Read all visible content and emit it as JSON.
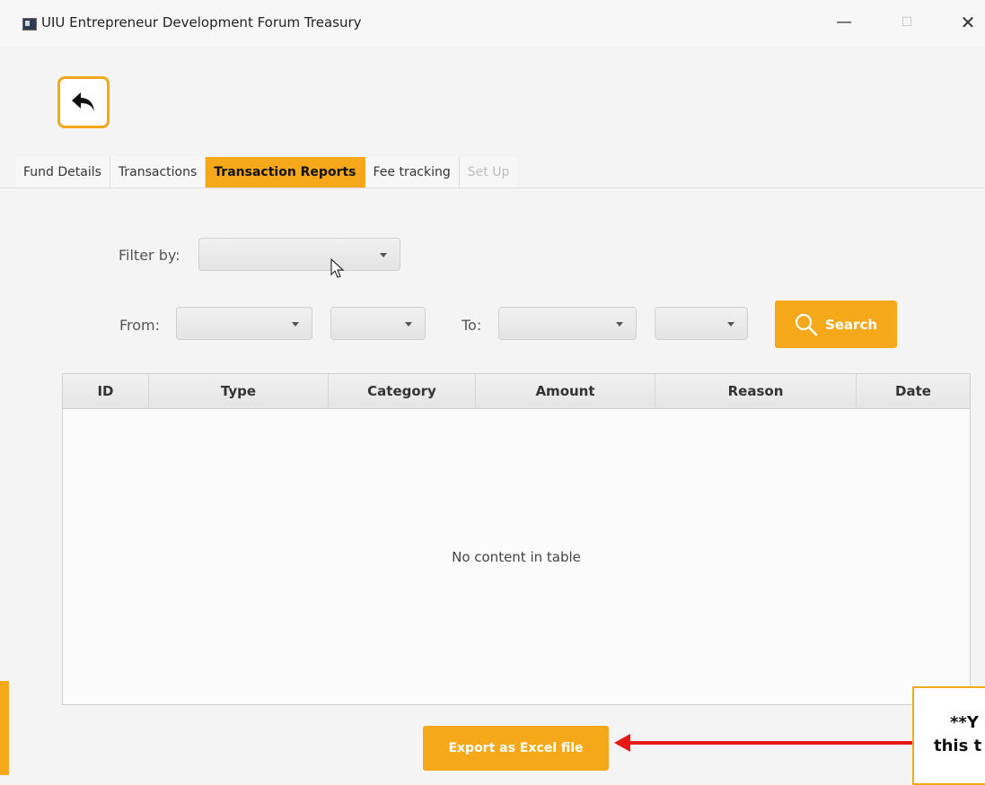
{
  "window": {
    "title": "UIU Entrepreneur Development Forum Treasury",
    "minimize": "—",
    "maximize": "☐",
    "close": "✕"
  },
  "tabs": [
    {
      "label": "Fund Details"
    },
    {
      "label": "Transactions"
    },
    {
      "label": "Transaction Reports"
    },
    {
      "label": "Fee tracking"
    },
    {
      "label": "Set Up"
    }
  ],
  "filter": {
    "label": "Filter by:",
    "from_label": "From:",
    "to_label": "To:",
    "search_label": "Search"
  },
  "table": {
    "columns": [
      "ID",
      "Type",
      "Category",
      "Amount",
      "Reason",
      "Date"
    ],
    "empty_text": "No content in table"
  },
  "export_label": "Export as Excel file",
  "note": {
    "line1": "**Y",
    "line2": "this t"
  },
  "colors": {
    "accent": "#f4a81a",
    "arrow": "#e81818"
  }
}
